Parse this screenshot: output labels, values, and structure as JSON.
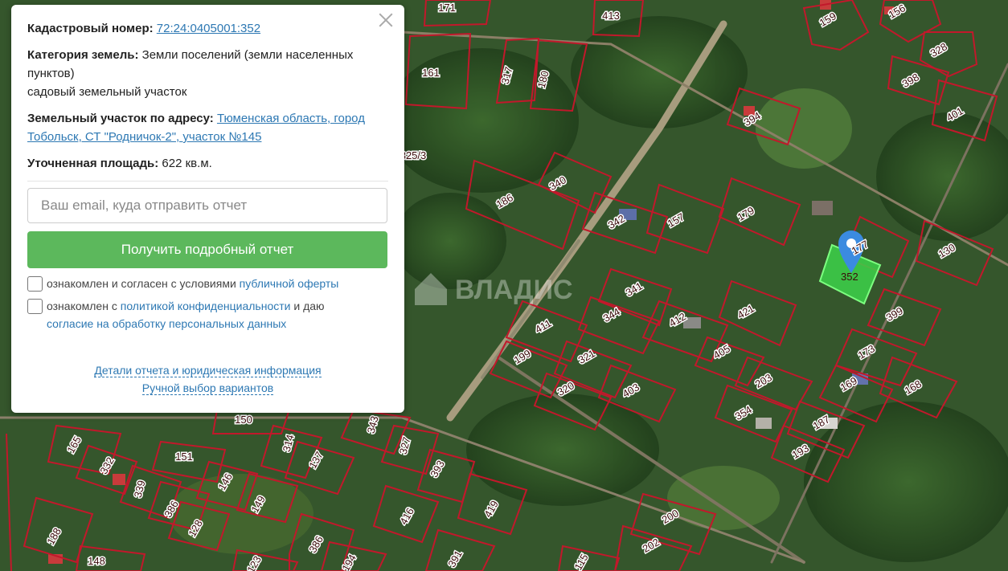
{
  "info": {
    "cadastral_label": "Кадастровый номер:",
    "cadastral_value": "72:24:0405001:352",
    "category_label": "Категория земель:",
    "category_value": "Земли поселений (земли населенных пунктов)",
    "category_subvalue": "садовый земельный участок",
    "address_label": "Земельный участок по адресу:",
    "address_value": "Тюменская область, город Тобольск, СТ \"Родничок-2\", участок №145",
    "area_label": "Уточненная площадь:",
    "area_value": "622 кв.м."
  },
  "form": {
    "email_placeholder": "Ваш email, куда отправить отчет",
    "submit_label": "Получить подробный отчет",
    "consent1_text": "ознакомлен и согласен с условиями",
    "consent1_link": "публичной оферты",
    "consent2_text_a": "ознакомлен с",
    "consent2_link_a": "политикой конфиденциальности",
    "consent2_text_b": "и даю",
    "consent2_link_b": "согласие на обработку персональных данных"
  },
  "links": {
    "details": "Детали отчета и юридическая информация",
    "manual": "Ручной выбор вариантов"
  },
  "watermark": "ВЛАДИС",
  "selected_parcel": "352",
  "parcels": [
    "171",
    "413",
    "159",
    "156",
    "328",
    "161",
    "317",
    "180",
    "398",
    "401",
    "394",
    "325/3",
    "340",
    "186",
    "342",
    "157",
    "179",
    "177",
    "130",
    "341",
    "421",
    "399",
    "411",
    "344",
    "412",
    "405",
    "173",
    "199",
    "321",
    "203",
    "169",
    "168",
    "320",
    "403",
    "354",
    "187",
    "150",
    "343",
    "165",
    "314",
    "327",
    "332",
    "151",
    "137",
    "393",
    "193",
    "146",
    "339",
    "386",
    "149",
    "128",
    "416",
    "419",
    "200",
    "188",
    "386",
    "148",
    "123",
    "194",
    "391",
    "115",
    "202"
  ],
  "colors": {
    "parcel_border": "#c2182b",
    "selected_fill": "#3cd24a",
    "pin": "#3b8be0",
    "button": "#5cb85c",
    "link": "#2d78b3"
  }
}
